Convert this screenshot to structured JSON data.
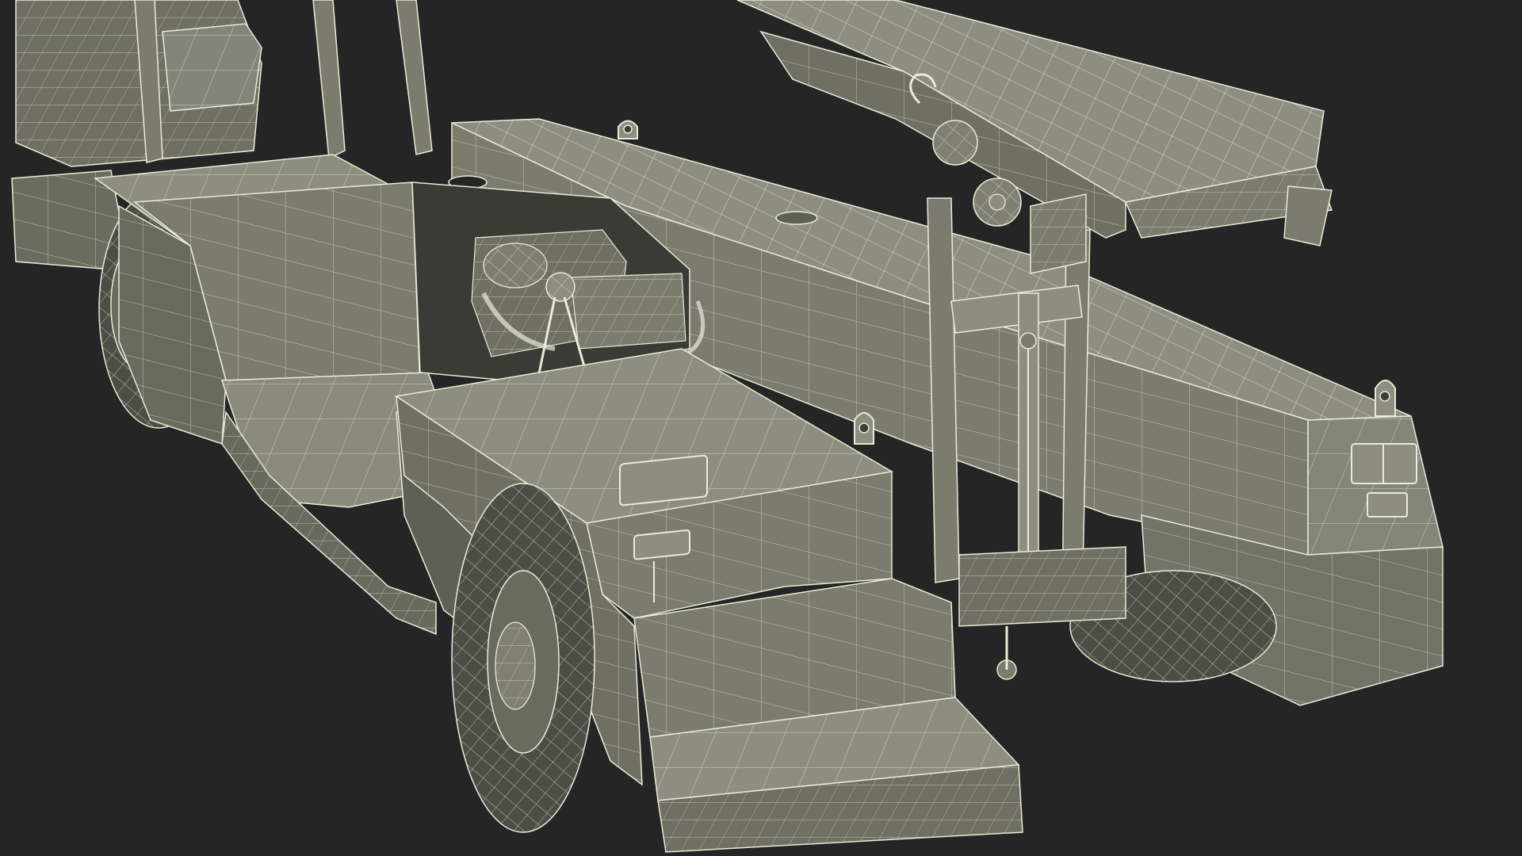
{
  "scene": {
    "subject": "mining-loader-wireframe",
    "colors": {
      "background": "#252525",
      "surface": "#7b7c6d",
      "surface_light": "#8d8e7f",
      "surface_dark": "#5f6055",
      "shadow": "#3e3f37",
      "wire": "#e9ead8",
      "wire_dim": "#b9baa8"
    }
  }
}
